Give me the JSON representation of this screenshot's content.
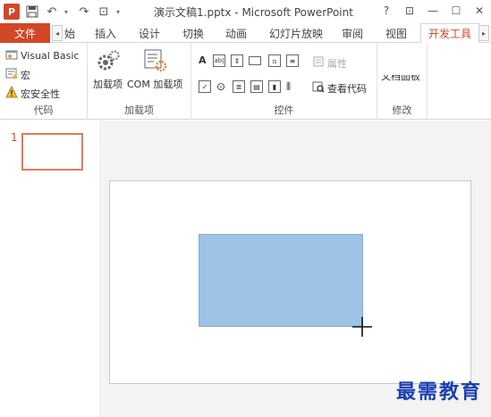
{
  "window": {
    "title": "演示文稿1.pptx - Microsoft PowerPoint",
    "logo_text": "P",
    "controls": [
      "?",
      "⊡",
      "—",
      "☐",
      "✕"
    ]
  },
  "tabs": {
    "file": "文件",
    "partial": "始",
    "items": [
      "插入",
      "设计",
      "切换",
      "动画",
      "幻灯片放映",
      "审阅",
      "视图",
      "开发工具"
    ],
    "active": "开发工具"
  },
  "ribbon": {
    "code": {
      "label": "代码",
      "visual_basic": "Visual Basic",
      "macro": "宏",
      "macro_security": "宏安全性"
    },
    "addins": {
      "label": "加载项",
      "addins_btn": "加载项",
      "com_addins_btn": "COM 加载项"
    },
    "controls": {
      "label": "控件",
      "properties": "属性",
      "view_code": "查看代码"
    },
    "modify": {
      "label": "修改",
      "doc_panel": "文档面板"
    }
  },
  "slides": {
    "current_number": "1"
  },
  "watermark": "最需教育",
  "colors": {
    "accent": "#d24726",
    "shape_fill": "#9dc3e6"
  }
}
